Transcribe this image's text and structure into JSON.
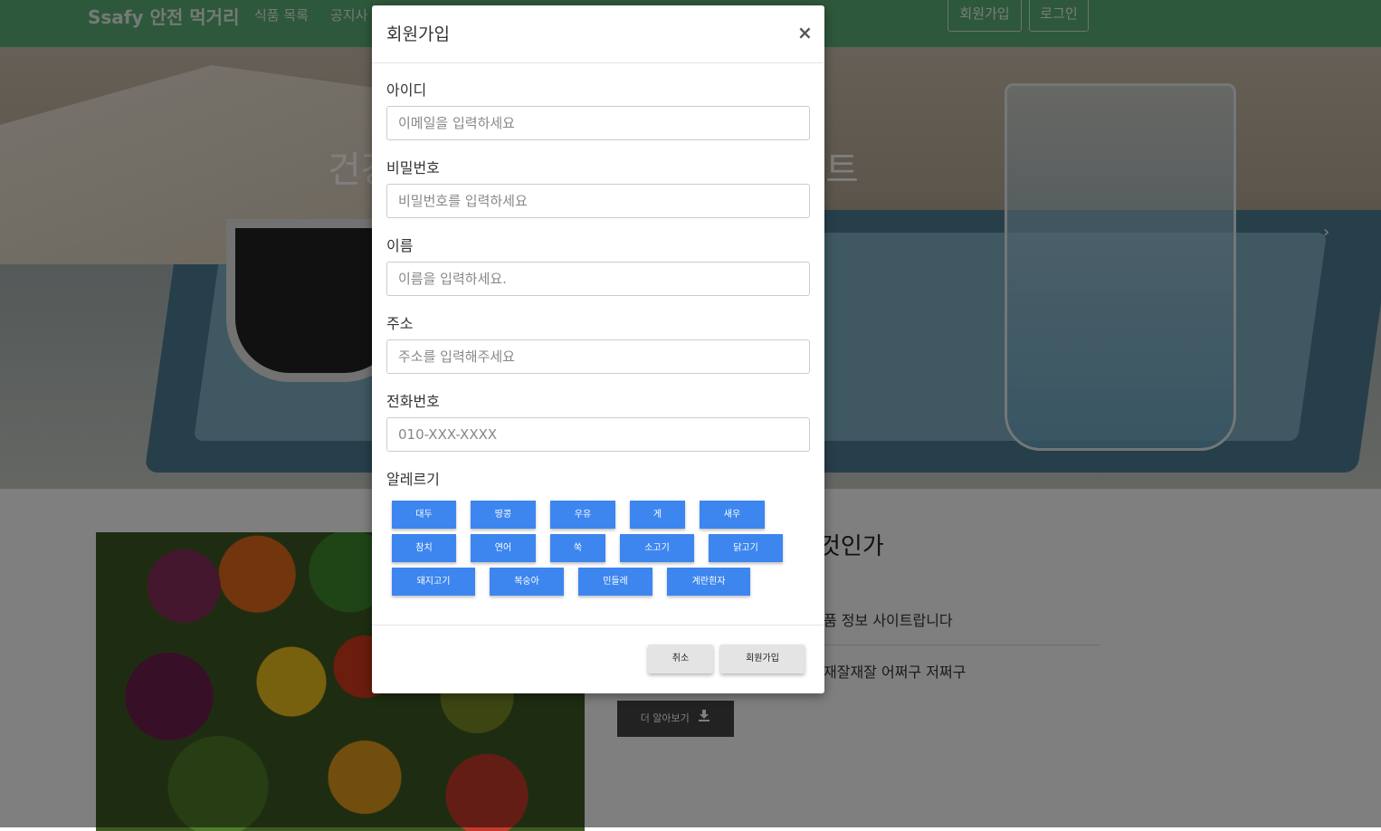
{
  "nav": {
    "brand": "Ssafy 안전 먹거리",
    "links": [
      "식품 목록",
      "공지사"
    ],
    "signup": "회원가입",
    "login": "로그인"
  },
  "hero": {
    "title_left": "건강",
    "title_right": "트",
    "next_arrow": "›"
  },
  "section": {
    "title": "것인가",
    "line1": "품 정보 사이트랍니다",
    "line2": "재잘재잘 어쩌구 저쩌구",
    "learn_more": "더 알아보기"
  },
  "modal": {
    "title": "회원가입",
    "close": "×",
    "fields": [
      {
        "label": "아이디",
        "placeholder": "이메일을 입력하세요"
      },
      {
        "label": "비밀번호",
        "placeholder": "비밀번호를 입력하세요"
      },
      {
        "label": "이름",
        "placeholder": "이름을 입력하세요."
      },
      {
        "label": "주소",
        "placeholder": "주소를 입력해주세요"
      },
      {
        "label": "전화번호",
        "placeholder": "010-XXX-XXXX"
      }
    ],
    "allergy_label": "알레르기",
    "allergies": [
      "대두",
      "땅콩",
      "우유",
      "게",
      "새우",
      "참치",
      "연어",
      "쑥",
      "소고기",
      "닭고기",
      "돼지고기",
      "복숭아",
      "민들레",
      "계란흰자"
    ],
    "cancel": "취소",
    "submit": "회원가입"
  },
  "colors": {
    "navbar": "#5cb077",
    "allergy_button": "#3d86ef",
    "learn_button": "#444444"
  }
}
